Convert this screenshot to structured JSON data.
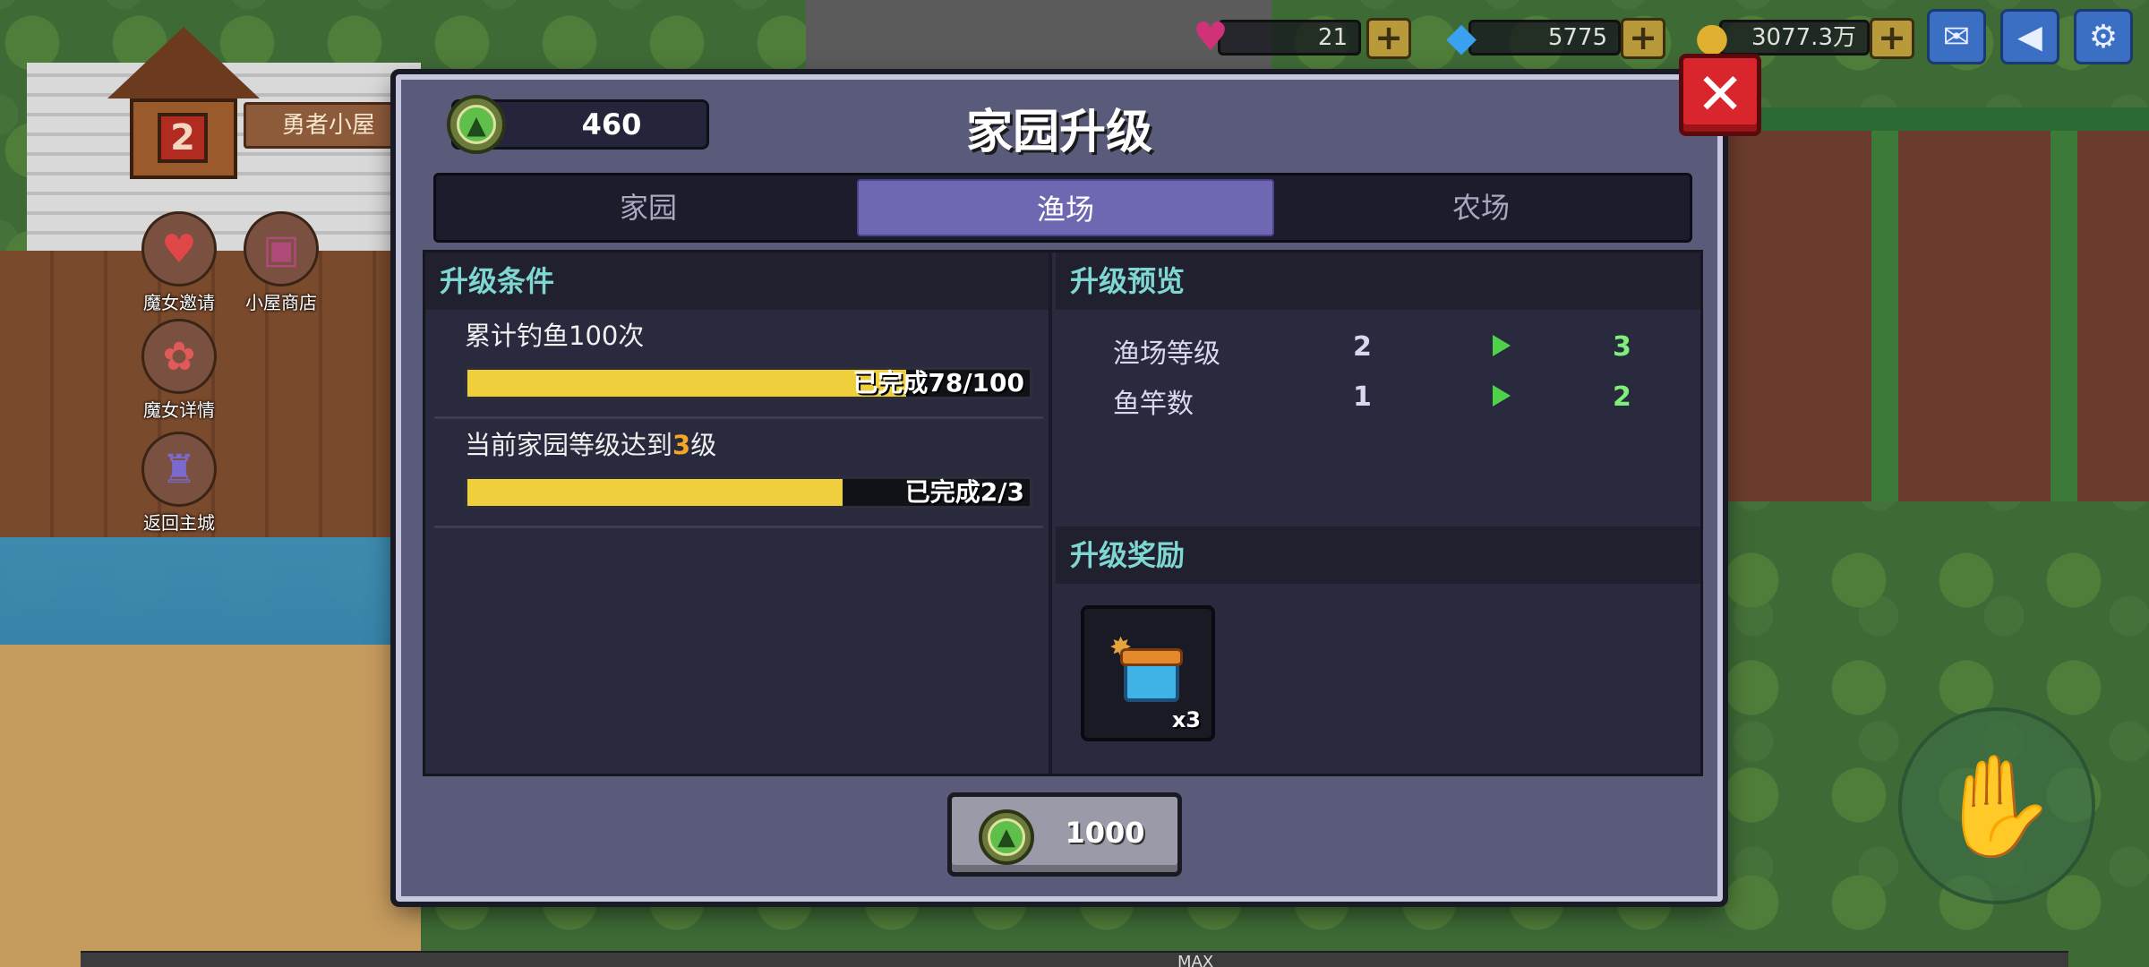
{
  "hud": {
    "hearts": {
      "icon": "heart-gem-icon",
      "value": "21"
    },
    "diamonds": {
      "icon": "diamond-icon",
      "value": "5775"
    },
    "gold": {
      "icon": "gold-coin-icon",
      "value": "3077.3万"
    },
    "plus_label": "+",
    "buttons": [
      {
        "icon": "mail-icon"
      },
      {
        "icon": "announcement-icon"
      },
      {
        "icon": "settings-icon"
      }
    ]
  },
  "world": {
    "house_number": "2",
    "house_label": "勇者小屋",
    "side_buttons": [
      {
        "label": "魔女邀请",
        "icon": "heart-icon"
      },
      {
        "label": "小屋商店",
        "icon": "shop-icon"
      },
      {
        "label": "魔女详情",
        "icon": "witch-icon"
      },
      {
        "label": "返回主城",
        "icon": "castle-icon"
      }
    ],
    "bottom_label": "MAX",
    "joystick_icon": "hand-icon"
  },
  "dialog": {
    "title": "家园升级",
    "points": "460",
    "tabs": [
      {
        "label": "家园",
        "active": false
      },
      {
        "label": "渔场",
        "active": true
      },
      {
        "label": "农场",
        "active": false
      }
    ],
    "conditions_header": "升级条件",
    "conditions": [
      {
        "title": "累计钓鱼100次",
        "progress_text": "已完成78/100",
        "progress": 0.78
      },
      {
        "title_before": "当前家园等级达到",
        "title_highlight": "3",
        "title_after": "级",
        "progress_text": "已完成2/3",
        "progress": 0.6667
      }
    ],
    "preview_header": "升级预览",
    "preview": [
      {
        "name": "渔场等级",
        "from": "2",
        "to": "3"
      },
      {
        "name": "鱼竿数",
        "from": "1",
        "to": "2"
      }
    ],
    "reward_header": "升级奖励",
    "rewards": [
      {
        "icon": "treasure-chest-icon",
        "qty": "x3"
      }
    ],
    "upgrade_cost": "1000",
    "close_icon": "close-icon"
  },
  "colors": {
    "section_heading": "#7fd7d2",
    "progress_fill": "#f0cf3c",
    "active_tab": "#6e68b2",
    "close_button": "#d8262c",
    "arrow": "#4fd24a"
  }
}
